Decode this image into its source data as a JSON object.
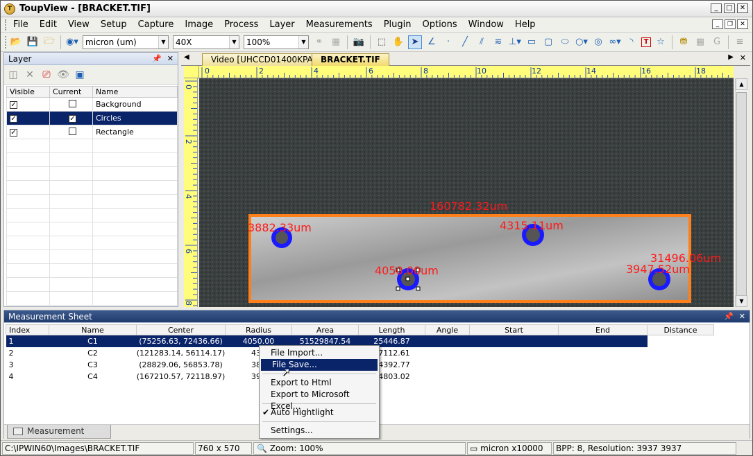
{
  "window": {
    "title": "ToupView - [BRACKET.TIF]"
  },
  "menu": [
    "File",
    "Edit",
    "View",
    "Setup",
    "Capture",
    "Image",
    "Process",
    "Layer",
    "Measurements",
    "Plugin",
    "Options",
    "Window",
    "Help"
  ],
  "toolbar": {
    "unit": "micron (um)",
    "magnification": "40X",
    "zoom": "100%"
  },
  "layer_panel": {
    "title": "Layer",
    "columns": [
      "Visible",
      "Current",
      "Name"
    ],
    "rows": [
      {
        "visible": true,
        "current": false,
        "name": "Background"
      },
      {
        "visible": true,
        "current": true,
        "name": "Circles"
      },
      {
        "visible": true,
        "current": false,
        "name": "Rectangle"
      }
    ]
  },
  "tabs": [
    "Video [UHCCD01400KPA]",
    "BRACKET.TIF"
  ],
  "ruler": {
    "h_ticks": [
      "0",
      "2",
      "4",
      "6",
      "8",
      "10",
      "12",
      "14",
      "16",
      "18"
    ],
    "v_ticks": [
      "0",
      "2",
      "4",
      "6",
      "8"
    ]
  },
  "overlay": {
    "rect_label": "160782.32um",
    "rect_side_label": "31496.06um",
    "circle_labels": [
      "3882.33um",
      "4315.11um",
      "4050.00um",
      "3947.52um"
    ],
    "annotation_color": "#ff1a1a",
    "circle_color": "#1a1aff",
    "rect_color": "#ff7f1a"
  },
  "measurement_sheet": {
    "title": "Measurement Sheet",
    "columns": [
      "Index",
      "Name",
      "Center",
      "Radius",
      "Area",
      "Length",
      "Angle",
      "Start",
      "End",
      "Distance"
    ],
    "rows": [
      [
        "1",
        "C1",
        "(75256.63, 72436.66)",
        "4050.00",
        "51529847.54",
        "25446.87",
        "",
        "",
        "",
        ""
      ],
      [
        "2",
        "C2",
        "(121283.14, 56114.17)",
        "431",
        "",
        "27112.61",
        "",
        "",
        "",
        ""
      ],
      [
        "3",
        "C3",
        "(28829.06, 56853.78)",
        "388",
        "",
        "24392.77",
        "",
        "",
        "",
        ""
      ],
      [
        "4",
        "C4",
        "(167210.57, 72118.97)",
        "394",
        "",
        "24803.02",
        "",
        "",
        "",
        ""
      ]
    ],
    "tab_label": "Measurement Sheet"
  },
  "context_menu": {
    "items": [
      "File Import...",
      "File Save...",
      "Export to Html",
      "Export to Microsoft Excel...",
      "Auto Hightlight",
      "Settings..."
    ]
  },
  "statusbar": {
    "path": "C:\\IPWIN60\\Images\\BRACKET.TIF",
    "size": "760 x 570",
    "zoom": "Zoom: 100%",
    "unit": "micron x10000",
    "info": "BPP: 8, Resolution: 3937 3937"
  }
}
